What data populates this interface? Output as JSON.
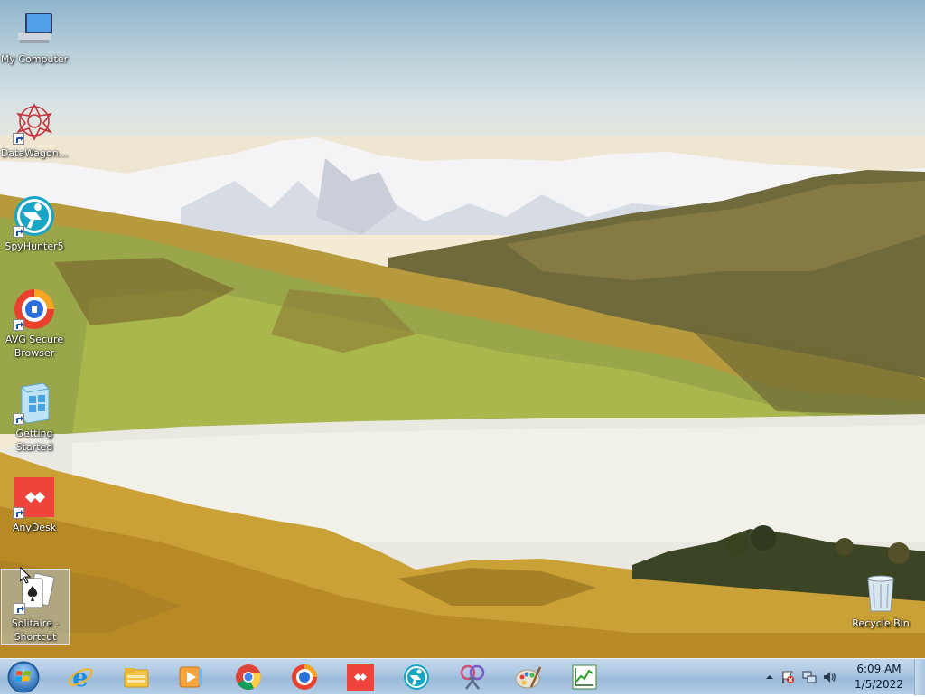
{
  "desktop": {
    "icons": [
      {
        "label": "My Computer",
        "icon": "computer-icon"
      },
      {
        "label": "DataWagon...",
        "icon": "datawagon-icon"
      },
      {
        "label": "SpyHunter5",
        "icon": "spyhunter-icon"
      },
      {
        "label": "AVG Secure Browser",
        "icon": "avg-browser-icon"
      },
      {
        "label": "Getting Started",
        "icon": "getting-started-icon"
      },
      {
        "label": "AnyDesk",
        "icon": "anydesk-icon"
      },
      {
        "label": "Solitaire - Shortcut",
        "icon": "solitaire-icon"
      },
      {
        "label": "Recycle Bin",
        "icon": "recycle-bin-icon"
      }
    ],
    "selected_icon": "Solitaire - Shortcut"
  },
  "taskbar": {
    "start": "start-orb",
    "pinned": [
      "internet-explorer-icon",
      "file-explorer-icon",
      "media-player-icon",
      "chrome-icon",
      "avg-browser-icon",
      "anydesk-icon",
      "spyhunter-icon",
      "snipping-tool-icon",
      "paint-icon",
      "chart-app-icon"
    ],
    "tray": {
      "icons": [
        "show-hidden-icons-arrow",
        "action-center-flag-icon",
        "network-icon",
        "volume-icon"
      ],
      "time": "6:09 AM",
      "date": "1/5/2022"
    }
  }
}
